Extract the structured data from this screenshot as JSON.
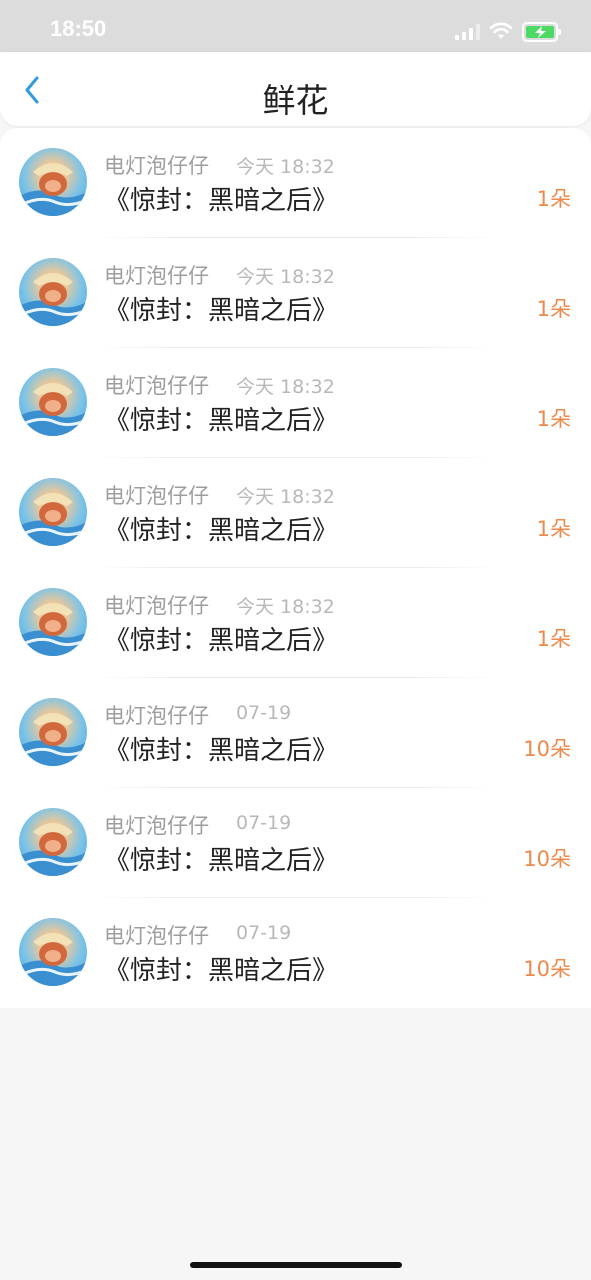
{
  "status_bar": {
    "time": "18:50"
  },
  "header": {
    "title": "鲜花"
  },
  "items": [
    {
      "name": "电灯泡仔仔",
      "time": "今天 18:32",
      "title": "《惊封：黑暗之后》",
      "count": "1朵"
    },
    {
      "name": "电灯泡仔仔",
      "time": "今天 18:32",
      "title": "《惊封：黑暗之后》",
      "count": "1朵"
    },
    {
      "name": "电灯泡仔仔",
      "time": "今天 18:32",
      "title": "《惊封：黑暗之后》",
      "count": "1朵"
    },
    {
      "name": "电灯泡仔仔",
      "time": "今天 18:32",
      "title": "《惊封：黑暗之后》",
      "count": "1朵"
    },
    {
      "name": "电灯泡仔仔",
      "time": "今天 18:32",
      "title": "《惊封：黑暗之后》",
      "count": "1朵"
    },
    {
      "name": "电灯泡仔仔",
      "time": "07-19",
      "title": "《惊封：黑暗之后》",
      "count": "10朵"
    },
    {
      "name": "电灯泡仔仔",
      "time": "07-19",
      "title": "《惊封：黑暗之后》",
      "count": "10朵"
    },
    {
      "name": "电灯泡仔仔",
      "time": "07-19",
      "title": "《惊封：黑暗之后》",
      "count": "10朵"
    }
  ],
  "colors": {
    "accent": "#2f9be0",
    "count": "#ec8a4c",
    "battery": "#4cd964"
  }
}
